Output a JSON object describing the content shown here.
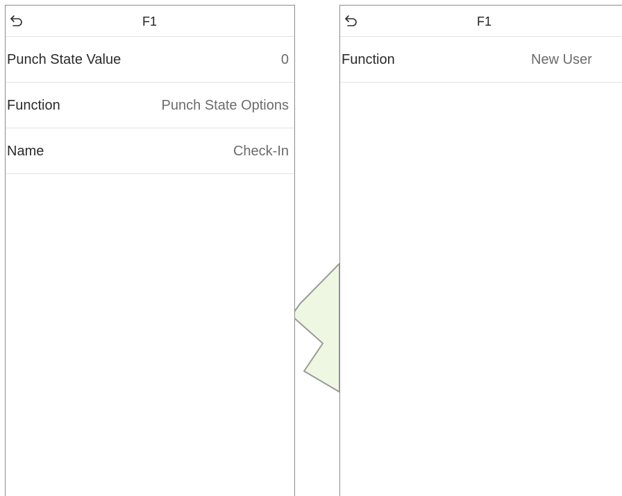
{
  "left_screen": {
    "title": "F1",
    "rows": [
      {
        "label": "Punch State Value",
        "value": "0"
      },
      {
        "label": "Function",
        "value": "Punch State Options"
      },
      {
        "label": "Name",
        "value": "Check-In"
      }
    ]
  },
  "right_screen": {
    "title": "F1",
    "rows": [
      {
        "label": "Function",
        "value": "New User"
      }
    ]
  },
  "colors": {
    "arrow_fill": "#eef7e2",
    "arrow_stroke": "#9a9a9a",
    "divider": "#e3e3e3",
    "label": "#2a2a2a",
    "value": "#6b6b6b"
  },
  "icons": {
    "back": "undo-arrow-icon",
    "transition": "transition-arrow-icon"
  }
}
